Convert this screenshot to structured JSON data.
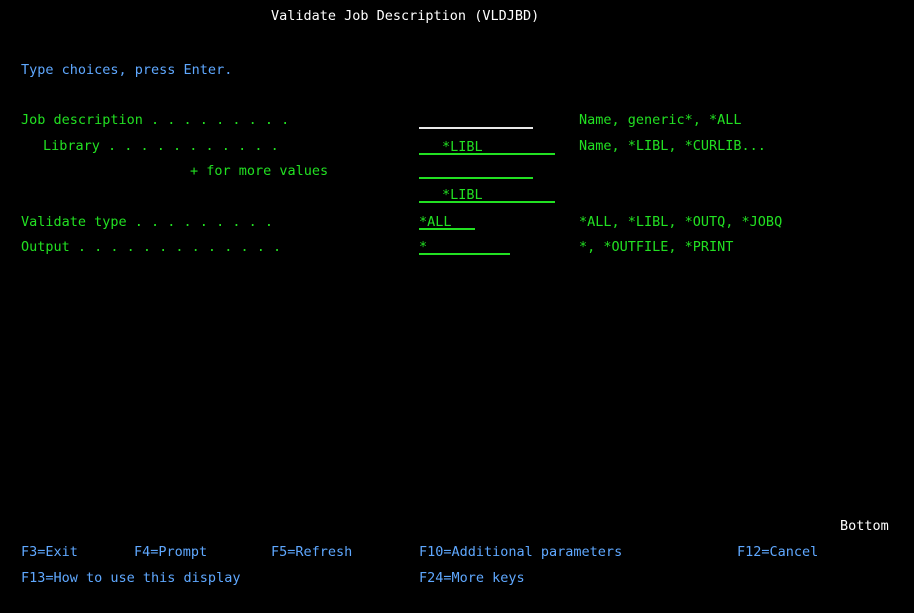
{
  "screen": {
    "title": "Validate Job Description (VLDJBD)",
    "instruction": "Type choices, press Enter.",
    "bottom_marker": "Bottom"
  },
  "fields": {
    "job_description": {
      "label": "Job description . . . . . . . . .",
      "value": "",
      "help": "Name, generic*, *ALL"
    },
    "library": {
      "label": "Library . . . . . . . . . . .",
      "value": "*LIBL",
      "help": "Name, *LIBL, *CURLIB..."
    },
    "more_values": {
      "label": "+ for more values",
      "value1": "",
      "value2": "*LIBL"
    },
    "validate_type": {
      "label": "Validate type . . . . . . . . .",
      "value": "*ALL",
      "help": "*ALL, *LIBL, *OUTQ, *JOBQ"
    },
    "output": {
      "label": "Output . . . . . . . . . . . . .",
      "value": "*",
      "help": "*, *OUTFILE, *PRINT"
    }
  },
  "function_keys": {
    "row1": [
      "F3=Exit",
      "F4=Prompt",
      "F5=Refresh",
      "F10=Additional parameters",
      "F12=Cancel"
    ],
    "row2": [
      "F13=How to use this display",
      "F24=More keys"
    ]
  }
}
